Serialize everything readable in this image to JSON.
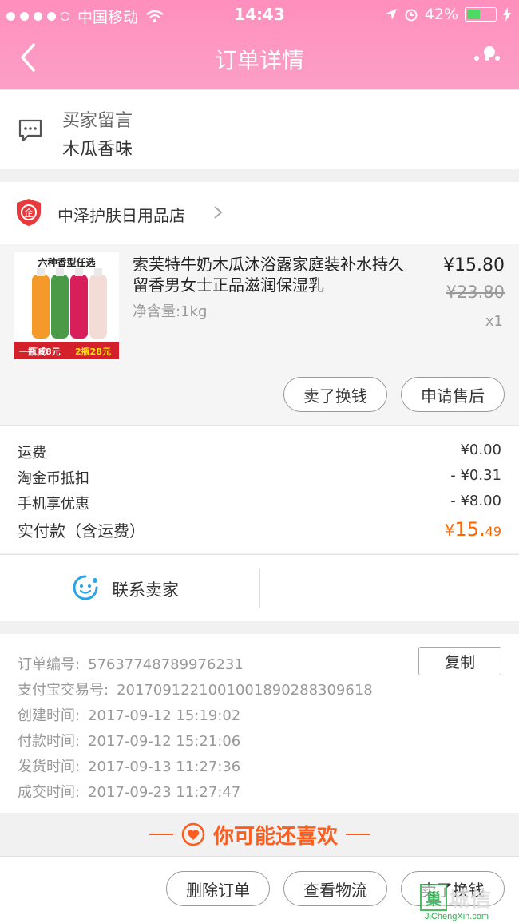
{
  "status_bar": {
    "carrier": "中国移动",
    "time": "14:43",
    "battery": "42%"
  },
  "nav": {
    "title": "订单详情"
  },
  "buyer_message": {
    "title": "买家留言",
    "text": "木瓜香味"
  },
  "shop": {
    "name": "中泽护肤日用品店"
  },
  "product": {
    "title": "索芙特牛奶木瓜沐浴露家庭装补水持久留香男女士正品滋润保湿乳",
    "spec": "净含量:1kg",
    "price": "¥15.80",
    "original_price": "¥23.80",
    "quantity": "x1",
    "thumb_top_text": "六种香型任选",
    "thumb_bottom_left": "一瓶减8元",
    "thumb_bottom_right": "2瓶28元",
    "buttons": [
      "卖了换钱",
      "申请售后"
    ]
  },
  "fees": {
    "shipping_label": "运费",
    "shipping_value": "¥0.00",
    "coin_label": "淘金币抵扣",
    "coin_value": "- ¥0.31",
    "mobile_label": "手机享优惠",
    "mobile_value": "- ¥8.00",
    "total_label": "实付款（含运费）",
    "total_currency": "¥",
    "total_int": "15.",
    "total_dec": "49"
  },
  "contact": {
    "label": "联系卖家"
  },
  "order_info": {
    "copy_label": "复制",
    "rows": [
      {
        "label": "订单编号:",
        "value": "57637748789976231"
      },
      {
        "label": "支付宝交易号:",
        "value": "2017091221001001890288309618"
      },
      {
        "label": "创建时间:",
        "value": "2017-09-12 15:19:02"
      },
      {
        "label": "付款时间:",
        "value": "2017-09-12 15:21:06"
      },
      {
        "label": "发货时间:",
        "value": "2017-09-13 11:27:36"
      },
      {
        "label": "成交时间:",
        "value": "2017-09-23 11:27:47"
      }
    ]
  },
  "recommend": {
    "title": "你可能还喜欢"
  },
  "bottom_actions": [
    "删除订单",
    "查看物流",
    "卖了换钱"
  ],
  "watermark": {
    "main": "城信",
    "box": "巢",
    "sub": "JiChengXin.com"
  },
  "colors": {
    "header": "#fc9fc6",
    "accent": "#ff6600",
    "recommend": "#ff5d1d"
  }
}
